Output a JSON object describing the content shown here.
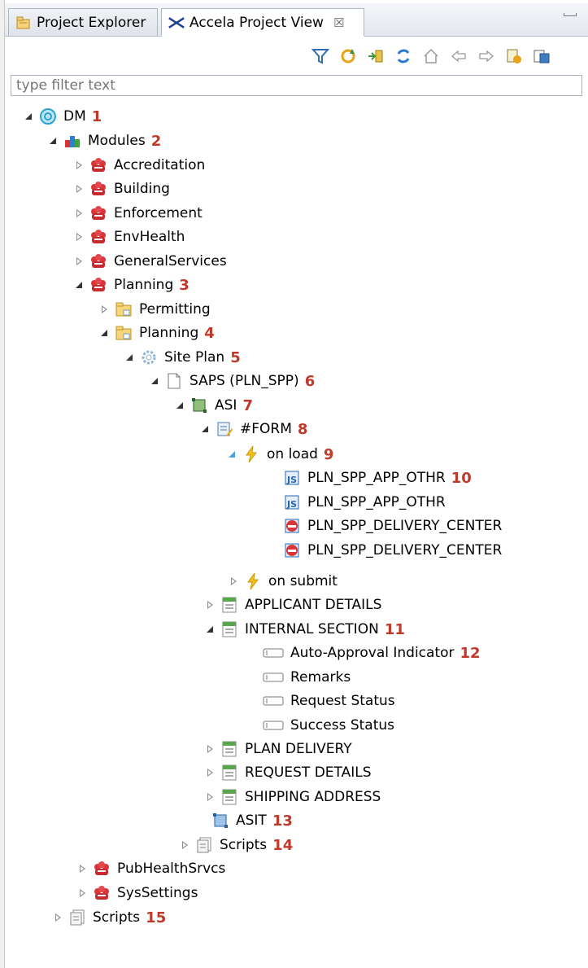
{
  "tabs": [
    {
      "label": "Project Explorer",
      "icon": "folder-tree-icon"
    },
    {
      "label": "Accela Project View",
      "icon": "accela-logo-icon"
    }
  ],
  "toolbar": {
    "buttons": [
      "filter-icon",
      "refresh-icon",
      "import-icon",
      "sync-icon",
      "home-icon",
      "back-icon",
      "forward-icon",
      "settings-icon",
      "deploy-icon"
    ]
  },
  "filter": {
    "placeholder": "type filter text"
  },
  "colors": {
    "annotation": "#c0392b",
    "tab_active": "#ffffff",
    "tab_border": "#aeb6c2"
  },
  "tree": [
    {
      "label": "DM",
      "num": "1",
      "icon": "globe-icon",
      "twisty": "exp"
    },
    {
      "label": "Modules",
      "num": "2",
      "icon": "modules-icon",
      "twisty": "exp"
    },
    {
      "label": "Accreditation",
      "num": "",
      "icon": "module-cube-icon",
      "twisty": "col"
    },
    {
      "label": "Building",
      "num": "",
      "icon": "module-cube-icon",
      "twisty": "col"
    },
    {
      "label": "Enforcement",
      "num": "",
      "icon": "module-cube-icon",
      "twisty": "col"
    },
    {
      "label": "EnvHealth",
      "num": "",
      "icon": "module-cube-icon",
      "twisty": "col"
    },
    {
      "label": "GeneralServices",
      "num": "",
      "icon": "module-cube-icon",
      "twisty": "col"
    },
    {
      "label": "Planning",
      "num": "3",
      "icon": "module-cube-icon",
      "twisty": "exp"
    },
    {
      "label": "Permitting",
      "num": "",
      "icon": "folder-icon",
      "twisty": "col"
    },
    {
      "label": "Planning",
      "num": "4",
      "icon": "folder-icon",
      "twisty": "exp"
    },
    {
      "label": "Site Plan",
      "num": "5",
      "icon": "gear-icon",
      "twisty": "exp"
    },
    {
      "label": "SAPS (PLN_SPP)",
      "num": "6",
      "icon": "document-icon",
      "twisty": "exp"
    },
    {
      "label": "ASI",
      "num": "7",
      "icon": "asi-icon",
      "twisty": "exp"
    },
    {
      "label": "#FORM",
      "num": "8",
      "icon": "form-icon",
      "twisty": "exp"
    },
    {
      "label": "on load",
      "num": "9",
      "icon": "lightning-icon",
      "twisty": "exp-blue"
    },
    {
      "label": "PLN_SPP_APP_OTHR",
      "num": "10",
      "icon": "script-blue-icon",
      "twisty": "none"
    },
    {
      "label": "PLN_SPP_APP_OTHR",
      "num": "",
      "icon": "script-blue-icon",
      "twisty": "none"
    },
    {
      "label": "PLN_SPP_DELIVERY_CENTER",
      "num": "",
      "icon": "script-red-icon",
      "twisty": "none"
    },
    {
      "label": "PLN_SPP_DELIVERY_CENTER",
      "num": "",
      "icon": "script-red-icon",
      "twisty": "none"
    },
    {
      "label": "on submit",
      "num": "",
      "icon": "lightning-icon",
      "twisty": "col"
    },
    {
      "label": "APPLICANT DETAILS",
      "num": "",
      "icon": "subgroup-icon",
      "twisty": "col"
    },
    {
      "label": "INTERNAL SECTION",
      "num": "11",
      "icon": "subgroup-icon",
      "twisty": "exp"
    },
    {
      "label": "Auto-Approval Indicator",
      "num": "12",
      "icon": "field-icon",
      "twisty": "none"
    },
    {
      "label": "Remarks",
      "num": "",
      "icon": "field-icon",
      "twisty": "none"
    },
    {
      "label": "Request Status",
      "num": "",
      "icon": "field-icon",
      "twisty": "none"
    },
    {
      "label": "Success Status",
      "num": "",
      "icon": "field-icon",
      "twisty": "none"
    },
    {
      "label": "PLAN DELIVERY",
      "num": "",
      "icon": "subgroup-icon",
      "twisty": "col"
    },
    {
      "label": "REQUEST DETAILS",
      "num": "",
      "icon": "subgroup-icon",
      "twisty": "col"
    },
    {
      "label": "SHIPPING ADDRESS",
      "num": "",
      "icon": "subgroup-icon",
      "twisty": "col"
    },
    {
      "label": "ASIT",
      "num": "13",
      "icon": "asit-icon",
      "twisty": "none"
    },
    {
      "label": "Scripts",
      "num": "14",
      "icon": "scripts-icon",
      "twisty": "col"
    },
    {
      "label": "PubHealthSrvcs",
      "num": "",
      "icon": "module-cube-icon",
      "twisty": "col"
    },
    {
      "label": "SysSettings",
      "num": "",
      "icon": "module-cube-icon",
      "twisty": "col"
    },
    {
      "label": "Scripts",
      "num": "15",
      "icon": "scripts-icon",
      "twisty": "col"
    }
  ]
}
